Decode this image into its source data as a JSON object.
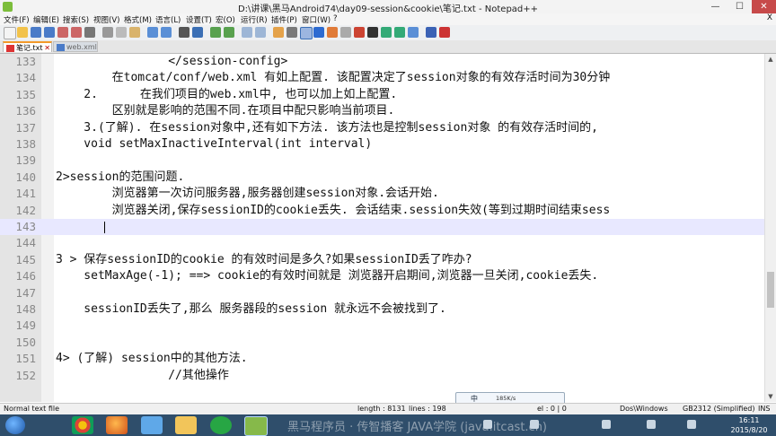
{
  "window": {
    "title": "D:\\讲课\\黑马Android74\\day09-session&cookie\\笔记.txt - Notepad++",
    "minimize": "—",
    "maximize": "☐",
    "close": "✕"
  },
  "menu": {
    "items": [
      "文件(F)",
      "编辑(E)",
      "搜索(S)",
      "视图(V)",
      "格式(M)",
      "语言(L)",
      "设置(T)",
      "宏(O)",
      "运行(R)",
      "插件(P)",
      "窗口(W)",
      "?"
    ],
    "close": "X"
  },
  "tabs": [
    {
      "label": "笔记.txt",
      "close": "✕"
    },
    {
      "label": "web.xml",
      "close": ""
    }
  ],
  "editor": {
    "lines": [
      {
        "num": "133",
        "text": "                </session-config>"
      },
      {
        "num": "134",
        "text": "        在tomcat/conf/web.xml 有如上配置. 该配置决定了session对象的有效存活时间为30分钟"
      },
      {
        "num": "135",
        "text": "    2.      在我们项目的web.xml中, 也可以加上如上配置."
      },
      {
        "num": "136",
        "text": "        区别就是影响的范围不同.在项目中配只影响当前项目."
      },
      {
        "num": "137",
        "text": "    3.(了解). 在session对象中,还有如下方法. 该方法也是控制session对象 的有效存活时间的,"
      },
      {
        "num": "138",
        "text": "    void setMaxInactiveInterval(int interval)"
      },
      {
        "num": "139",
        "text": ""
      },
      {
        "num": "140",
        "text": "2>session的范围问题."
      },
      {
        "num": "141",
        "text": "        浏览器第一次访问服务器,服务器创建session对象.会话开始."
      },
      {
        "num": "142",
        "text": "        浏览器关闭,保存sessionID的cookie丢失. 会话结束.session失效(等到过期时间结束sess"
      },
      {
        "num": "143",
        "text": ""
      },
      {
        "num": "144",
        "text": ""
      },
      {
        "num": "145",
        "text": "3 > 保存sessionID的cookie 的有效时间是多久?如果sessionID丢了咋办?"
      },
      {
        "num": "146",
        "text": "    setMaxAge(-1); ==> cookie的有效时间就是 浏览器开启期间,浏览器一旦关闭,cookie丢失."
      },
      {
        "num": "147",
        "text": ""
      },
      {
        "num": "148",
        "text": "    sessionID丢失了,那么 服务器段的session 就永远不会被找到了."
      },
      {
        "num": "149",
        "text": ""
      },
      {
        "num": "150",
        "text": ""
      },
      {
        "num": "151",
        "text": "4> (了解) session中的其他方法."
      },
      {
        "num": "152",
        "text": "                //其他操作"
      }
    ]
  },
  "ime": {
    "text": "中",
    "speed": "185K/s"
  },
  "status": {
    "file_type": "Normal text file",
    "length": "length : 8131",
    "lines": "lines : 198",
    "position": "el : 0 | 0",
    "eol": "Dos\\Windows",
    "encoding": "GB2312 (Simplified)",
    "mode": "INS"
  },
  "taskbar": {
    "watermark": "黑马程序员 · 传智播客 JAVA学院 (java.itcast.cn)",
    "time": "16:11",
    "date": "2015/8/20"
  },
  "colors": {
    "current_line": "#e8e8ff",
    "tab_accent": "#f39a2b",
    "taskbar": "#2f4e6b"
  }
}
